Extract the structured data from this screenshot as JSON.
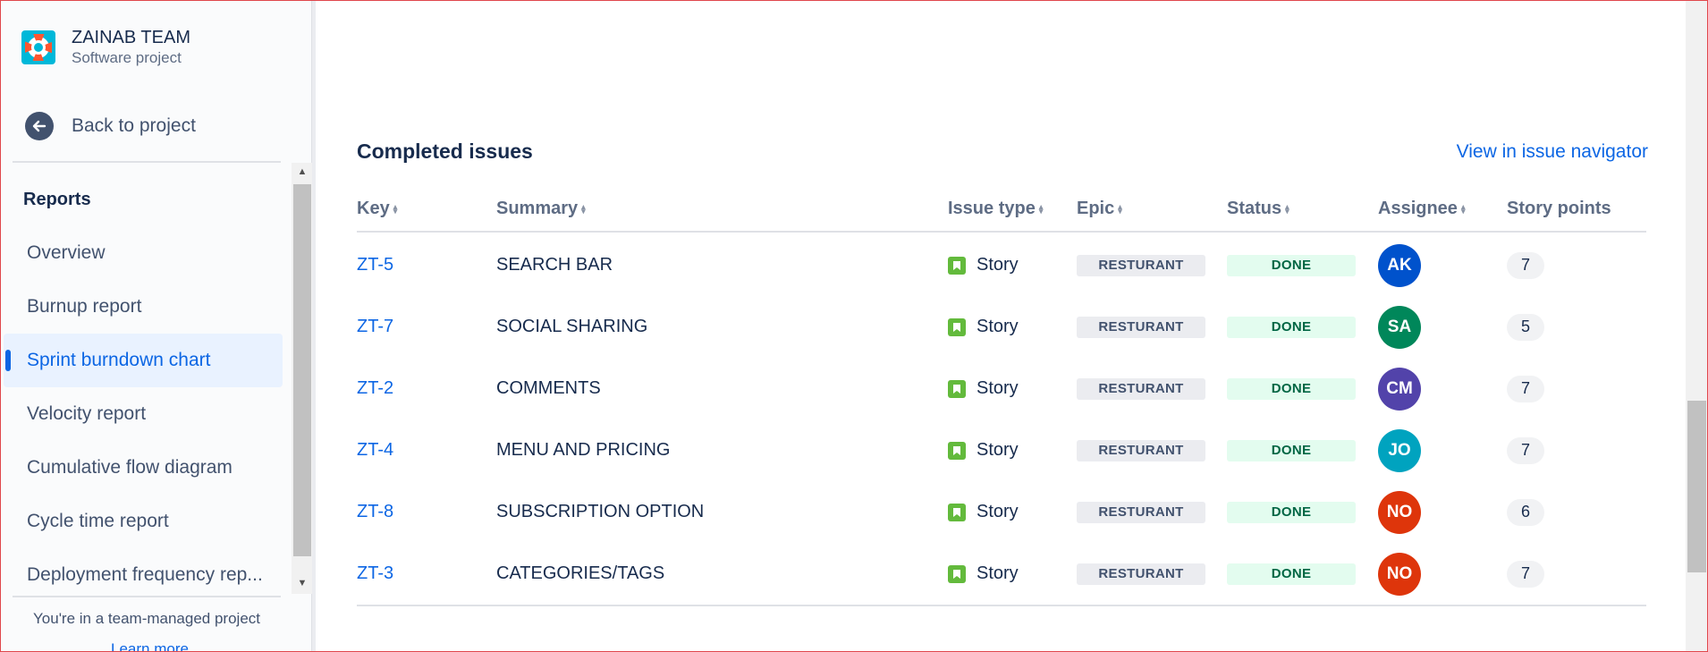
{
  "project": {
    "name": "ZAINAB TEAM",
    "type": "Software project",
    "icon": "lifebuoy-icon"
  },
  "sidebar": {
    "back_label": "Back to project",
    "reports_heading": "Reports",
    "items": [
      {
        "label": "Overview",
        "active": false
      },
      {
        "label": "Burnup report",
        "active": false
      },
      {
        "label": "Sprint burndown chart",
        "active": true
      },
      {
        "label": "Velocity report",
        "active": false
      },
      {
        "label": "Cumulative flow diagram",
        "active": false
      },
      {
        "label": "Cycle time report",
        "active": false
      },
      {
        "label": "Deployment frequency rep...",
        "active": false
      }
    ],
    "team_note": "You're in a team-managed project",
    "learn_more": "Learn more"
  },
  "section": {
    "title": "Completed issues",
    "view_link": "View in issue navigator"
  },
  "table": {
    "columns": [
      "Key",
      "Summary",
      "Issue type",
      "Epic",
      "Status",
      "Assignee",
      "Story points"
    ],
    "rows": [
      {
        "key": "ZT-5",
        "summary": "SEARCH BAR",
        "type": "Story",
        "epic": "RESTURANT",
        "status": "DONE",
        "assignee": "AK",
        "avatar_color": "#0052cc",
        "points": "7"
      },
      {
        "key": "ZT-7",
        "summary": "SOCIAL SHARING",
        "type": "Story",
        "epic": "RESTURANT",
        "status": "DONE",
        "assignee": "SA",
        "avatar_color": "#00875a",
        "points": "5"
      },
      {
        "key": "ZT-2",
        "summary": "COMMENTS",
        "type": "Story",
        "epic": "RESTURANT",
        "status": "DONE",
        "assignee": "CM",
        "avatar_color": "#5243aa",
        "points": "7"
      },
      {
        "key": "ZT-4",
        "summary": "MENU AND PRICING",
        "type": "Story",
        "epic": "RESTURANT",
        "status": "DONE",
        "assignee": "JO",
        "avatar_color": "#00a3bf",
        "points": "7"
      },
      {
        "key": "ZT-8",
        "summary": "SUBSCRIPTION OPTION",
        "type": "Story",
        "epic": "RESTURANT",
        "status": "DONE",
        "assignee": "NO",
        "avatar_color": "#de350b",
        "points": "6"
      },
      {
        "key": "ZT-3",
        "summary": "CATEGORIES/TAGS",
        "type": "Story",
        "epic": "RESTURANT",
        "status": "DONE",
        "assignee": "NO",
        "avatar_color": "#de350b",
        "points": "7"
      }
    ]
  },
  "colors": {
    "link": "#0c66e4",
    "active_bg": "#e9f2ff",
    "story": "#63ba3c",
    "done_bg": "#e3fcef",
    "done_text": "#006644"
  }
}
